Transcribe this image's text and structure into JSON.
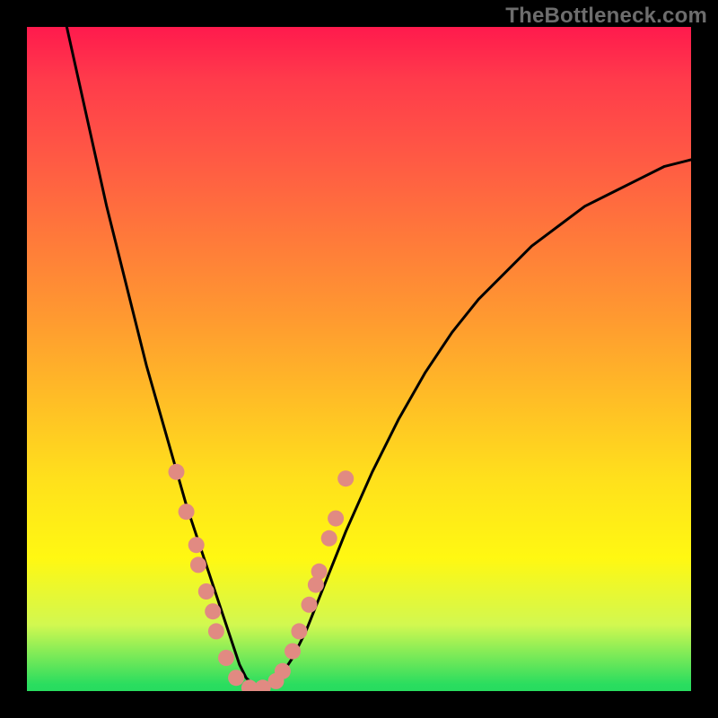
{
  "watermark": "TheBottleneck.com",
  "chart_data": {
    "type": "line",
    "title": "",
    "xlabel": "",
    "ylabel": "",
    "xlim": [
      0,
      100
    ],
    "ylim": [
      0,
      100
    ],
    "grid": false,
    "legend": false,
    "background_gradient_top_color": "#ff1a4d",
    "background_gradient_bottom_color": "#28dc5f",
    "series": [
      {
        "name": "bottleneck-curve",
        "color": "#000000",
        "x": [
          6,
          8,
          10,
          12,
          14,
          16,
          18,
          20,
          22,
          24,
          26,
          28,
          29,
          30,
          31,
          32,
          33,
          34,
          35,
          36,
          38,
          40,
          42,
          44,
          48,
          52,
          56,
          60,
          64,
          68,
          72,
          76,
          80,
          84,
          88,
          92,
          96,
          100
        ],
        "y": [
          100,
          91,
          82,
          73,
          65,
          57,
          49,
          42,
          35,
          28,
          22,
          16,
          13,
          10,
          7,
          4,
          2,
          1,
          0.5,
          0.5,
          2,
          5,
          9,
          14,
          24,
          33,
          41,
          48,
          54,
          59,
          63,
          67,
          70,
          73,
          75,
          77,
          79,
          80
        ]
      }
    ],
    "markers": {
      "name": "salmon-dots",
      "color": "#e18a82",
      "radius_px": 9,
      "points": [
        {
          "x": 22.5,
          "y": 33
        },
        {
          "x": 24.0,
          "y": 27
        },
        {
          "x": 25.5,
          "y": 22
        },
        {
          "x": 25.8,
          "y": 19
        },
        {
          "x": 27.0,
          "y": 15
        },
        {
          "x": 28.0,
          "y": 12
        },
        {
          "x": 28.5,
          "y": 9
        },
        {
          "x": 30.0,
          "y": 5
        },
        {
          "x": 31.5,
          "y": 2
        },
        {
          "x": 33.5,
          "y": 0.5
        },
        {
          "x": 35.5,
          "y": 0.5
        },
        {
          "x": 37.5,
          "y": 1.5
        },
        {
          "x": 38.5,
          "y": 3
        },
        {
          "x": 40.0,
          "y": 6
        },
        {
          "x": 41.0,
          "y": 9
        },
        {
          "x": 42.5,
          "y": 13
        },
        {
          "x": 43.5,
          "y": 16
        },
        {
          "x": 44.0,
          "y": 18
        },
        {
          "x": 45.5,
          "y": 23
        },
        {
          "x": 46.5,
          "y": 26
        },
        {
          "x": 48.0,
          "y": 32
        }
      ]
    }
  }
}
